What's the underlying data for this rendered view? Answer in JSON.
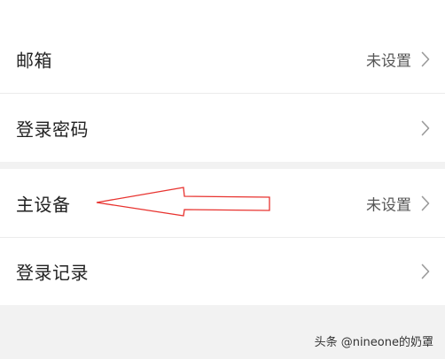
{
  "settings": {
    "rows": [
      {
        "label": "邮箱",
        "value": "未设置"
      },
      {
        "label": "登录密码",
        "value": ""
      },
      {
        "label": "主设备",
        "value": "未设置"
      },
      {
        "label": "登录记录",
        "value": ""
      }
    ]
  },
  "annotation": {
    "type": "red-outline-arrow",
    "color": "#e8332f",
    "points_to": "主设备"
  },
  "watermark": {
    "text": "头条 @nineone的奶罩"
  },
  "icons": {
    "row_chevron": "chevron-right-icon"
  }
}
